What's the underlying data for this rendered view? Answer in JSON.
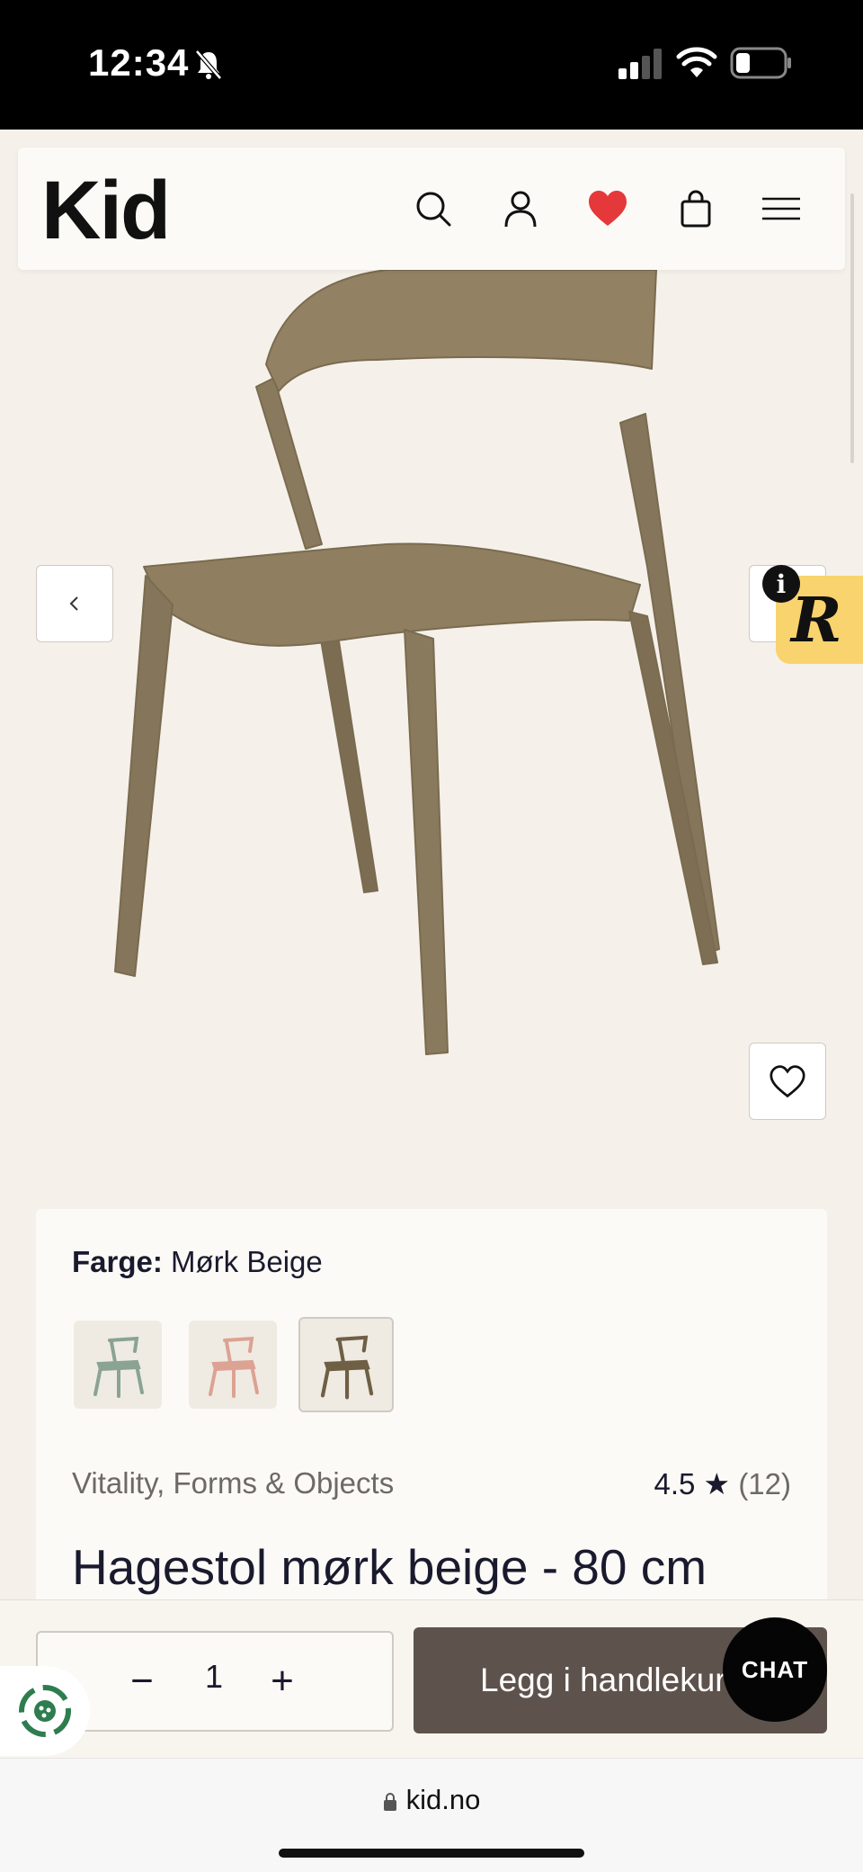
{
  "status_bar": {
    "time": "12:34"
  },
  "header": {
    "logo": "Kid",
    "icons": [
      "search-icon",
      "user-icon",
      "heart-icon",
      "bag-icon",
      "menu-icon"
    ],
    "accent_heart": "#e5383b"
  },
  "gallery": {
    "chair_color": "#8d7c5e",
    "prev_icon": "chevron-left-icon",
    "next_icon": "chevron-right-icon"
  },
  "product": {
    "color_label": "Farge:",
    "color_value": "Mørk Beige",
    "swatches": [
      {
        "name": "green",
        "color": "#8aa393"
      },
      {
        "name": "pink",
        "color": "#dca293"
      },
      {
        "name": "dark-beige",
        "color": "#6e5f45",
        "selected": true
      }
    ],
    "brand": "Vitality, Forms & Objects",
    "rating": "4.5",
    "rating_star": "★",
    "review_count": "(12)",
    "title": "Hagestol mørk beige - 80 cm"
  },
  "cart_bar": {
    "quantity": "1",
    "minus": "−",
    "plus": "+",
    "add_label": "Legg i handlekurv",
    "button_color": "#5e524c"
  },
  "chat": {
    "label": "CHAT"
  },
  "browser": {
    "url": "kid.no"
  }
}
